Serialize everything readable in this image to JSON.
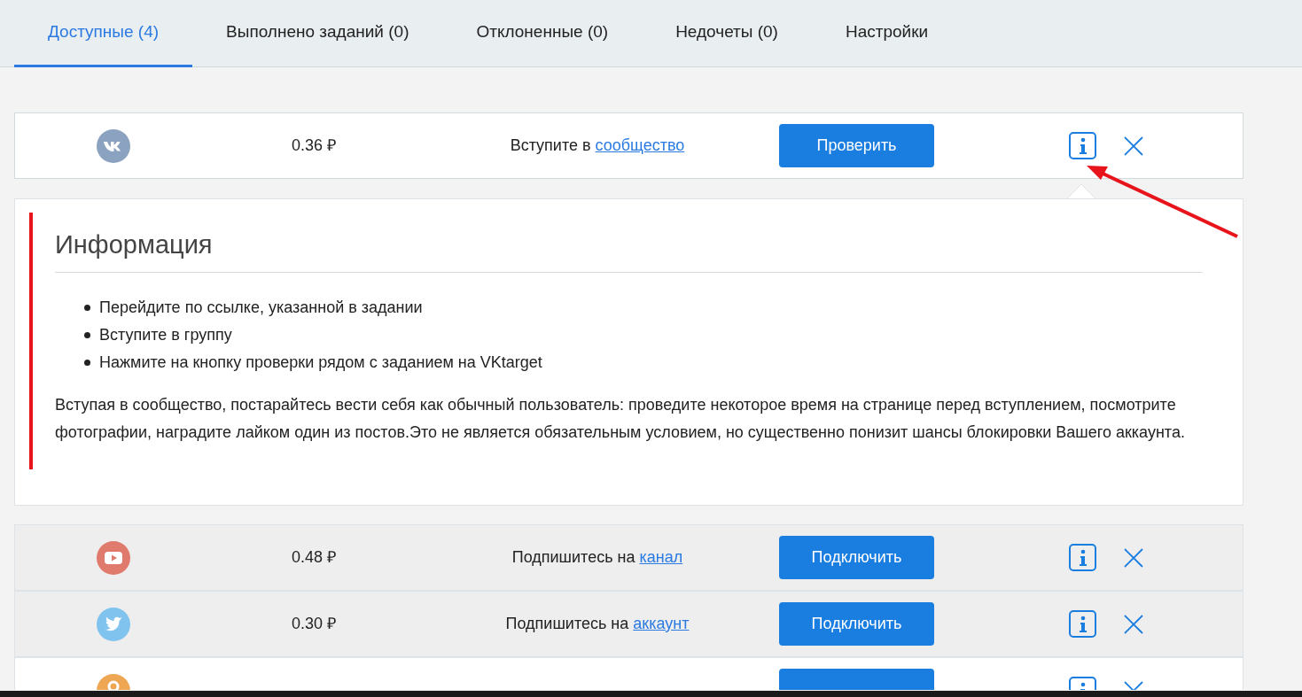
{
  "tabs": [
    {
      "label": "Доступные (4)",
      "selected": true
    },
    {
      "label": "Выполнено заданий (0)",
      "selected": false
    },
    {
      "label": "Отклоненные (0)",
      "selected": false
    },
    {
      "label": "Недочеты (0)",
      "selected": false
    },
    {
      "label": "Настройки",
      "selected": false
    }
  ],
  "tasks": [
    {
      "kind": "vk",
      "price": "0.36 ₽",
      "text": "Вступите в",
      "link": "сообщество",
      "button": "Проверить",
      "shaded": false,
      "expanded": true
    },
    {
      "kind": "youtube",
      "price": "0.48 ₽",
      "text": "Подпишитесь на",
      "link": "канал",
      "button": "Подключить",
      "shaded": true,
      "expanded": false
    },
    {
      "kind": "twitter",
      "price": "0.30 ₽",
      "text": "Подпишитесь на",
      "link": "аккаунт",
      "button": "Подключить",
      "shaded": true,
      "expanded": false
    },
    {
      "kind": "ok",
      "shaded": false,
      "expanded": false
    }
  ],
  "info": {
    "title": "Информация",
    "steps": [
      "Перейдите по ссылке, указанной в задании",
      "Вступите в группу",
      "Нажмите на кнопку проверки рядом с заданием на VKtarget"
    ],
    "note": "Вступая в сообщество, постарайтесь вести себя как обычный пользователь: проведите некоторое время на странице перед вступлением, посмотрите фотографии, наградите лайком один из постов.Это не является обязательным условием, но существенно понизит шансы блокировки Вашего аккаунта."
  }
}
